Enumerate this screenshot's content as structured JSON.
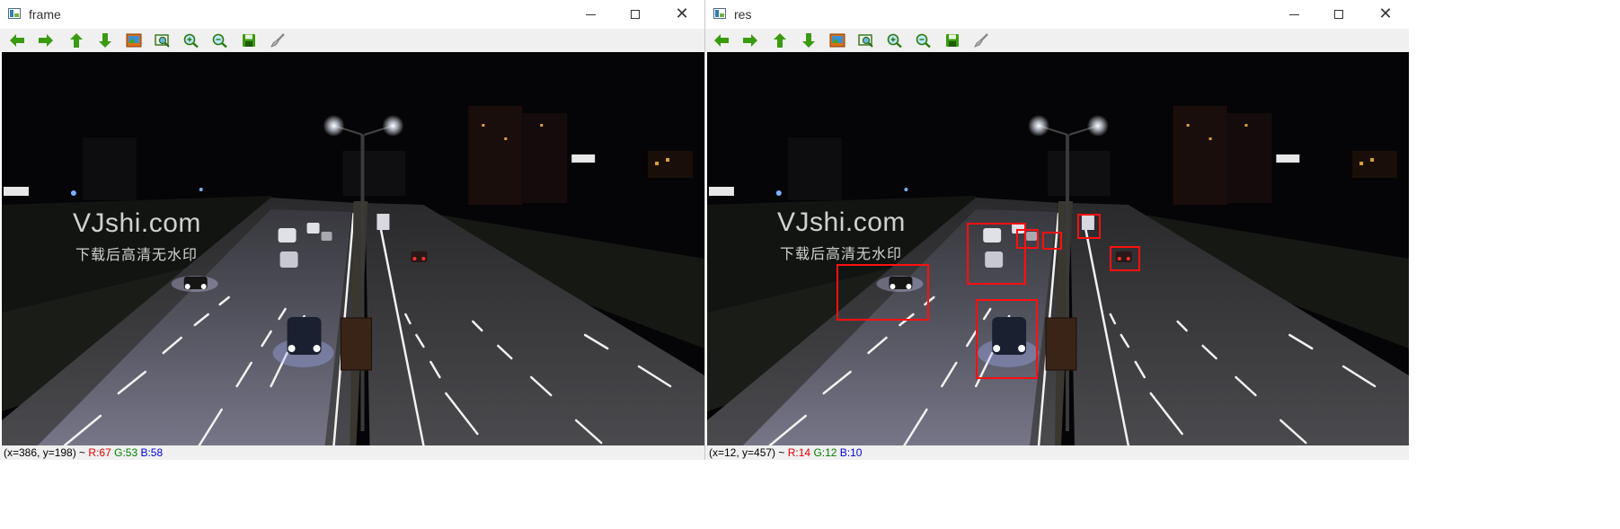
{
  "colors": {
    "titlebar_bg": "#ffffff",
    "toolbar_bg": "#f0f0f0",
    "icon_green": "#3a9a10",
    "detection_box": "#ff1010",
    "status_r": "#e00000",
    "status_g": "#008000",
    "status_b": "#0000e0"
  },
  "toolbar_icons": [
    "arrow-left-icon",
    "arrow-right-icon",
    "arrow-up-icon",
    "arrow-down-icon",
    "save-image-icon",
    "zoom-fit-icon",
    "zoom-in-icon",
    "zoom-out-icon",
    "floppy-save-icon",
    "brush-properties-icon"
  ],
  "windows": {
    "frame": {
      "title": "frame",
      "watermark": {
        "main": "VJshi.com",
        "sub": "下载后高清无水印"
      },
      "status": {
        "coords": "(x=386, y=198) ~",
        "r": "R:67",
        "g": "G:53",
        "b": "B:58"
      }
    },
    "res": {
      "title": "res",
      "watermark": {
        "main": "VJshi.com",
        "sub": "下载后高清无水印"
      },
      "status": {
        "coords": "(x=12, y=457) ~",
        "r": "R:14",
        "g": "G:12",
        "b": "B:10"
      },
      "detection_count": 7
    }
  }
}
